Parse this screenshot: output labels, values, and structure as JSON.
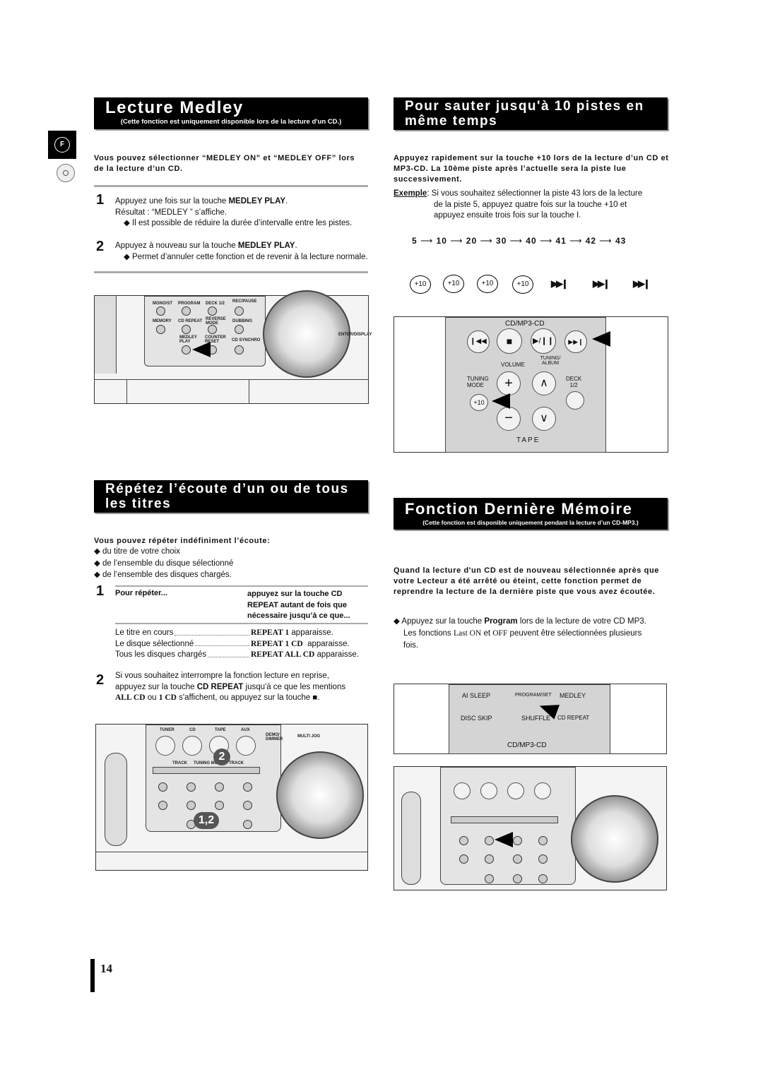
{
  "side_tab": {
    "letter": "F",
    "icon": "disc-icon"
  },
  "medley": {
    "title": "Lecture Medley",
    "subtitle": "(Cette fonction est uniquement disponible lors de la lecture d'un CD.)",
    "intro": "Vous pouvez sélectionner “MEDLEY ON” et “MEDLEY OFF” lors de la lecture d’un CD.",
    "steps": [
      {
        "n": "1",
        "pre": "Appuyez une fois sur la touche ",
        "key": "MEDLEY PLAY",
        "post": ".",
        "lines": [
          "Résultat : “MEDLEY ” s’affiche.",
          "◆ Il est possible de réduire la durée d’intervalle entre les pistes."
        ]
      },
      {
        "n": "2",
        "pre": "Appuyez à nouveau sur la touche ",
        "key": "MEDLEY PLAY",
        "post": ".",
        "lines": [
          "◆ Permet d’annuler cette fonction et de revenir à la lecture normale."
        ]
      }
    ],
    "device_labels": [
      "MONO/ST",
      "PROGRAM",
      "DECK 1/2",
      "REC/PAUSE",
      "MEMORY",
      "CD REPEAT",
      "REVERSE MODE",
      "DUBBING",
      "MEDLEY PLAY",
      "COUNTER RESET",
      "CD SYNCHRO",
      "ENTER/DISPLAY"
    ]
  },
  "skip": {
    "title": "Pour sauter jusqu'à 10 pistes en même temps",
    "intro": "Appuyez rapidement sur la touche +10 lors de la lecture d’un CD et MP3-CD. La 10ème piste après l’actuelle sera la piste lue successivement.",
    "example_label": "Exemple",
    "example_lines": [
      ": Si vous souhaitez sélectionner la piste 43 lors de la lecture",
      "de la piste 5, appuyez quatre fois sur la touche +10 et",
      "appuyez ensuite trois fois sur la touche     I."
    ],
    "sequence": [
      "5",
      "10",
      "20",
      "30",
      "40",
      "41",
      "42",
      "43"
    ],
    "buttons": [
      "+10",
      "+10",
      "+10",
      "+10"
    ],
    "remote_labels": {
      "section": "CD/MP3-CD",
      "volume": "VOLUME",
      "tuning_album": "TUNING/ ALBUM",
      "tuning_mode": "TUNING MODE",
      "deck": "DECK 1/2",
      "plus10": "+10",
      "tape": "TAPE"
    }
  },
  "repeat": {
    "title": "Répétez l’écoute d’un ou de tous les titres",
    "intro": "Vous pouvez répéter indéfiniment l’écoute:",
    "bullets": [
      "◆ du titre de votre choix",
      "◆ de l’ensemble du disque sélectionné",
      "◆ de l’ensemble des disques chargés."
    ],
    "step1": {
      "n": "1",
      "col1": "Pour répéter...",
      "col2": "appuyez sur la touche CD REPEAT autant de fois que nécessaire jusqu’à ce que..."
    },
    "rows": [
      {
        "what": "Le titre en cours",
        "key": "REPEAT 1",
        "post": " apparaisse."
      },
      {
        "what": "Le disque sélectionné",
        "key": "REPEAT 1 CD",
        "post": "  apparaisse."
      },
      {
        "what": "Tous les disques chargés",
        "key": "REPEAT ALL CD",
        "post": " apparaisse."
      }
    ],
    "step2": {
      "n": "2",
      "l1": "Si vous souhaitez interrompre la fonction lecture en reprise,",
      "l2_pre": "appuyez sur la touche ",
      "l2_key": "CD REPEAT",
      "l2_post": " jusqu'à ce que les mentions",
      "l3_a": "ALL CD",
      "l3_b": " ou ",
      "l3_c": "1 CD",
      "l3_d": " s'affichent, ou appuyez sur la touche ■."
    },
    "callouts": [
      "2",
      "1,2"
    ],
    "device_labels": [
      "TUNER",
      "CD",
      "TAPE",
      "AUX",
      "DEMO/ DIMMER",
      "MULTI JOG",
      "TRACK",
      "TUNING MODE",
      "TRACK"
    ]
  },
  "memory": {
    "title": "Fonction Dernière Mémoire",
    "subtitle": "(Cette fonction est disponible uniquement pendant la lecture d’un CD-MP3.)",
    "intro": "Quand la lecture d'un CD est de nouveau sélectionnée après que votre Lecteur a été arrêté ou éteint, cette fonction permet de reprendre la lecture de la dernière piste que vous avez écoutée.",
    "bullet_pre": "◆ Appuyez sur la touche ",
    "bullet_key": "Program",
    "bullet_post": " lors de la lecture de votre CD MP3.",
    "line2_pre": "Les fonctions ",
    "line2_a": "Last ON",
    "line2_b": " et ",
    "line2_c": "OFF",
    "line2_post": " peuvent être sélectionnées plusieurs",
    "line3": "fois.",
    "remote_labels": [
      "AI SLEEP",
      "PROGRAM/SET",
      "MEDLEY",
      "DISC SKIP",
      "SHUFFLE",
      "CD REPEAT",
      "CD/MP3-CD"
    ]
  },
  "page_number": "14"
}
